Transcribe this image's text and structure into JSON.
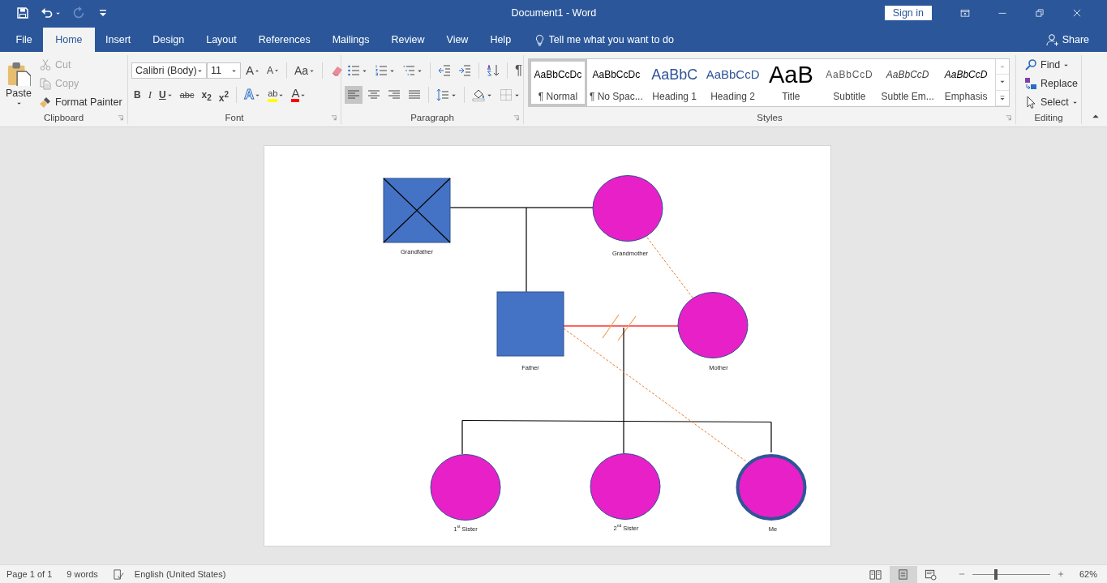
{
  "window": {
    "title": "Document1 - Word",
    "sign_in": "Sign in"
  },
  "quick_access": [
    {
      "kind": "save",
      "disabled": false
    },
    {
      "kind": "undo",
      "disabled": false
    },
    {
      "kind": "redo",
      "disabled": true
    },
    {
      "kind": "customize",
      "disabled": false
    }
  ],
  "tabs": [
    {
      "label": "File",
      "selected": false
    },
    {
      "label": "Home",
      "selected": true
    },
    {
      "label": "Insert",
      "selected": false
    },
    {
      "label": "Design",
      "selected": false
    },
    {
      "label": "Layout",
      "selected": false
    },
    {
      "label": "References",
      "selected": false
    },
    {
      "label": "Mailings",
      "selected": false
    },
    {
      "label": "Review",
      "selected": false
    },
    {
      "label": "View",
      "selected": false
    },
    {
      "label": "Help",
      "selected": false
    }
  ],
  "tell_me": {
    "placeholder": "Tell me what you want to do"
  },
  "share": "Share",
  "ribbon": {
    "clipboard": {
      "label": "Clipboard",
      "paste": "Paste",
      "commands": [
        {
          "kind": "cut",
          "label": "Cut",
          "disabled": true
        },
        {
          "kind": "copy",
          "label": "Copy",
          "disabled": true
        },
        {
          "kind": "painter",
          "label": "Format Painter",
          "disabled": false
        }
      ]
    },
    "font": {
      "label": "Font",
      "font_name": "Calibri (Body)",
      "font_size": "11",
      "row1": [
        {
          "kind": "grow",
          "label": "A"
        },
        {
          "kind": "shrink",
          "label": "A"
        },
        {
          "kind": "case",
          "label": "Aa"
        },
        {
          "kind": "clear"
        }
      ],
      "row2": [
        {
          "kind": "bold",
          "label": "B"
        },
        {
          "kind": "italic",
          "label": "I"
        },
        {
          "kind": "underline",
          "label": "U"
        },
        {
          "kind": "strike",
          "label": "abc"
        },
        {
          "kind": "subscript",
          "label": "x$_{2}$"
        },
        {
          "kind": "superscript",
          "label": "x$^{2}$"
        },
        {
          "kind": "effects",
          "label": "A"
        },
        {
          "kind": "highlight",
          "label": "ab",
          "color": "#ffff00"
        },
        {
          "kind": "color",
          "label": "A",
          "color": "#ff0000"
        }
      ]
    },
    "paragraph": {
      "label": "Paragraph",
      "row1": [
        {
          "kind": "bullets"
        },
        {
          "kind": "numbering"
        },
        {
          "kind": "multilevel"
        },
        {
          "kind": "outdent"
        },
        {
          "kind": "indent"
        },
        {
          "kind": "sort"
        },
        {
          "kind": "marks",
          "label": "¶"
        }
      ],
      "row2": [
        {
          "kind": "align-left",
          "selected": true
        },
        {
          "kind": "align-center",
          "selected": false
        },
        {
          "kind": "align-right",
          "selected": false
        },
        {
          "kind": "justify",
          "selected": false
        },
        {
          "kind": "spacing"
        },
        {
          "kind": "shading"
        },
        {
          "kind": "borders"
        }
      ]
    },
    "styles": {
      "label": "Styles",
      "items": [
        {
          "kind": "normal",
          "preview": "AaBbCcDc",
          "name": "¶ Normal",
          "selected": true
        },
        {
          "kind": "normal",
          "preview": "AaBbCcDc",
          "name": "¶ No Spac...",
          "selected": false
        },
        {
          "kind": "heading1",
          "preview": "AaBbC",
          "name": "Heading 1",
          "selected": false
        },
        {
          "kind": "heading2",
          "preview": "AaBbCcD",
          "name": "Heading 2",
          "selected": false
        },
        {
          "kind": "title",
          "preview": "AaB",
          "name": "Title",
          "selected": false
        },
        {
          "kind": "subtitle",
          "preview": "AaBbCcD",
          "name": "Subtitle",
          "selected": false
        },
        {
          "kind": "subtle",
          "preview": "AaBbCcD",
          "name": "Subtle Em...",
          "selected": false
        },
        {
          "kind": "emphasis",
          "preview": "AaBbCcD",
          "name": "Emphasis",
          "selected": false
        }
      ]
    },
    "editing": {
      "label": "Editing",
      "commands": [
        {
          "kind": "find",
          "label": "Find"
        },
        {
          "kind": "replace",
          "label": "Replace"
        },
        {
          "kind": "select",
          "label": "Select"
        }
      ]
    }
  },
  "pedigree": {
    "people": [
      {
        "label": "Grandfather",
        "kind": "male",
        "deceased": true,
        "highlighted": false
      },
      {
        "label": "Grandmother",
        "kind": "female",
        "deceased": false,
        "highlighted": false
      },
      {
        "label": "Father",
        "kind": "male",
        "deceased": false,
        "highlighted": false
      },
      {
        "label": "Mother",
        "kind": "female",
        "deceased": false,
        "highlighted": false
      },
      {
        "label": "1$^{st}$ Sister",
        "kind": "female",
        "deceased": false,
        "highlighted": false
      },
      {
        "label": "2$^{nd}$ Sister",
        "kind": "female",
        "deceased": false,
        "highlighted": false
      },
      {
        "label": "Me",
        "kind": "female",
        "deceased": false,
        "highlighted": true
      }
    ],
    "couples": [
      {
        "divorced": false
      },
      {
        "divorced": true
      }
    ]
  },
  "status_bar": {
    "page": "Page 1 of 1",
    "words": "9 words",
    "language": "English (United States)",
    "views": [
      {
        "kind": "read",
        "selected": false
      },
      {
        "kind": "print",
        "selected": true
      },
      {
        "kind": "web",
        "selected": false
      }
    ],
    "zoom": {
      "level": 0.3,
      "reading": "62%"
    }
  }
}
